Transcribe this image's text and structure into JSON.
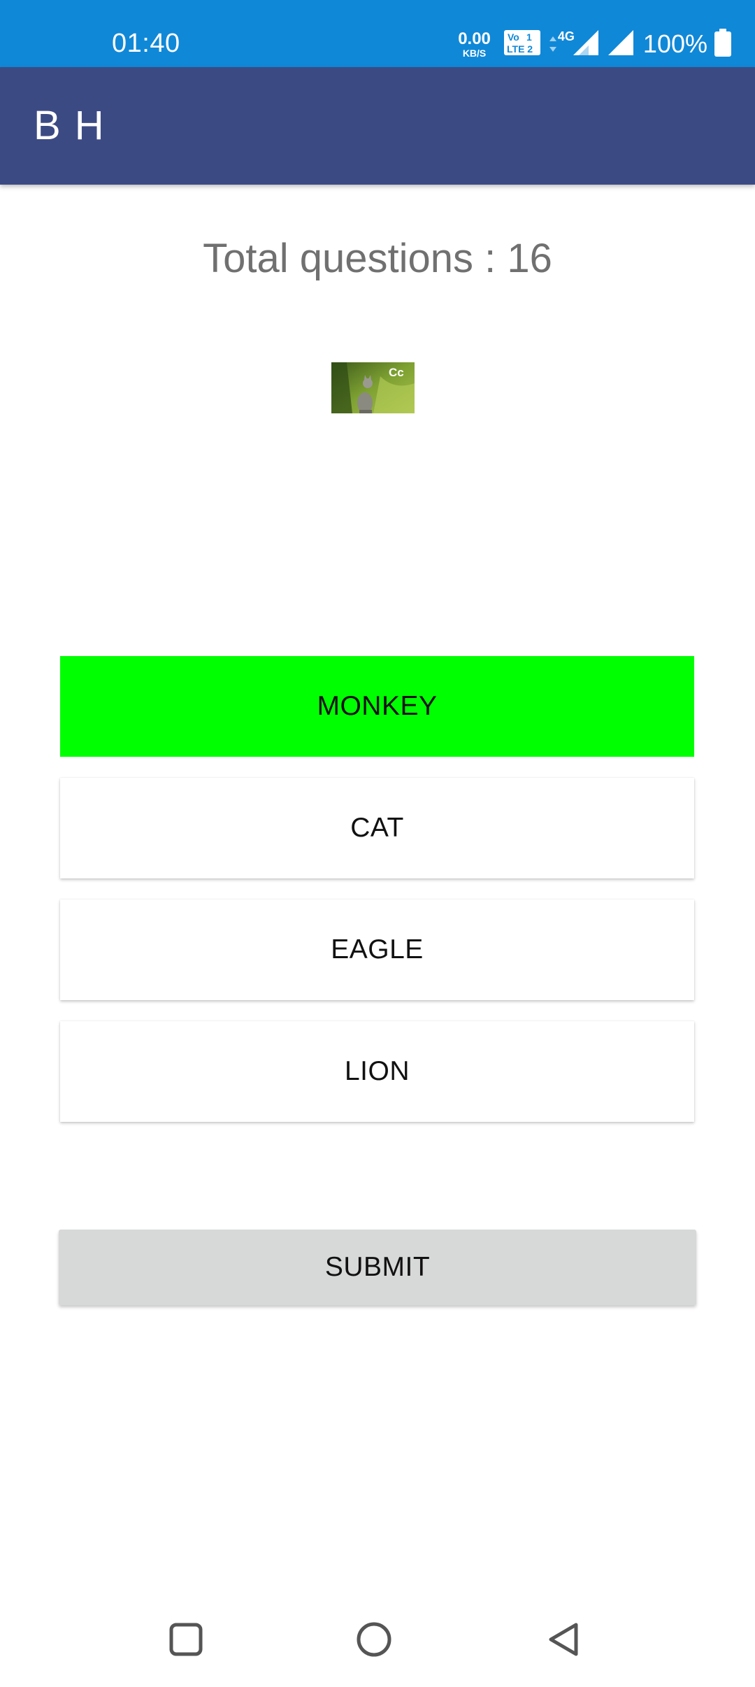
{
  "status_bar": {
    "time": "01:40",
    "net_speed_value": "0.00",
    "net_speed_unit": "KB/S",
    "network_type": "4G",
    "battery": "100%",
    "icons": [
      "volte-icon",
      "signal-icon",
      "signal-icon-2",
      "battery-icon"
    ]
  },
  "app_bar": {
    "title": "B H"
  },
  "quiz": {
    "total_questions": "Total questions : 16",
    "image_caption": "Cc",
    "options": [
      {
        "label": "MONKEY",
        "selected": true
      },
      {
        "label": "CAT",
        "selected": false
      },
      {
        "label": "EAGLE",
        "selected": false
      },
      {
        "label": "LION",
        "selected": false
      }
    ],
    "submit_label": "SUBMIT"
  },
  "colors": {
    "status_bar": "#1088d8",
    "app_bar": "#3c4a84",
    "selected_option": "#00ff00",
    "submit_bg": "#d7d8d8"
  },
  "nav_bar": {
    "icons": [
      "recents-icon",
      "home-icon",
      "back-icon"
    ]
  }
}
